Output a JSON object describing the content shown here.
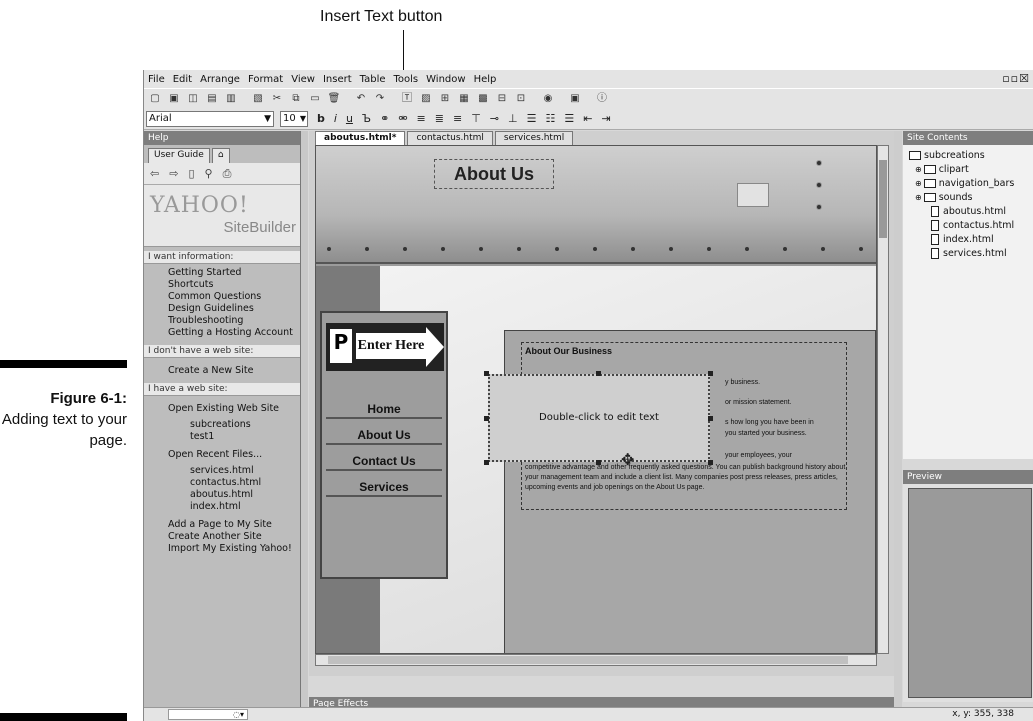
{
  "callout": "Insert Text button",
  "caption": {
    "label": "Figure 6-1:",
    "text": "Adding text to your page."
  },
  "menubar": {
    "items": [
      "File",
      "Edit",
      "Arrange",
      "Format",
      "View",
      "Insert",
      "Table",
      "Tools",
      "Window",
      "Help"
    ]
  },
  "format": {
    "font": "Arial",
    "size": "10"
  },
  "help_panel": {
    "title": "Help",
    "tab_guide": "User Guide",
    "yahoo": "YAHOO!",
    "sitebuilder": "SiteBuilder",
    "want_info": "I want information:",
    "info_links": [
      "Getting Started",
      "Shortcuts",
      "Common Questions",
      "Design Guidelines",
      "Troubleshooting",
      "Getting a Hosting Account"
    ],
    "no_site": "I don't have a web site:",
    "create_new": "Create a New Site",
    "have_site": "I have a web site:",
    "open_existing": "Open Existing Web Site",
    "sites": [
      "subcreations",
      "test1"
    ],
    "open_recent": "Open Recent Files...",
    "recent": [
      "services.html",
      "contactus.html",
      "aboutus.html",
      "index.html"
    ],
    "more": [
      "Add a Page to My Site",
      "Create Another Site",
      "Import My Existing Yahoo!"
    ]
  },
  "doc_tabs": [
    "aboutus.html*",
    "contactus.html",
    "services.html"
  ],
  "page": {
    "title": "About Us",
    "enter": "Enter Here",
    "nav": [
      "Home",
      "About Us",
      "Contact Us",
      "Services"
    ],
    "biz_heading": "About Our Business",
    "frag1": "y business.",
    "frag2": "or mission statement.",
    "frag3": "s how long you have been in",
    "frag4": "you started your business.",
    "frag5": "your employees, your",
    "biz_para": "competitive advantage and other frequently asked questions. You can publish background history about your management team and include a client list. Many companies post press releases, press articles, upcoming events and job openings on the About Us page.",
    "new_text": "Double-click to edit text"
  },
  "effects_title": "Page Effects",
  "site_contents": {
    "title": "Site Contents",
    "root": "subcreations",
    "folders": [
      "clipart",
      "navigation_bars",
      "sounds"
    ],
    "files": [
      "aboutus.html",
      "contactus.html",
      "index.html",
      "services.html"
    ]
  },
  "preview_title": "Preview",
  "status": {
    "coords": "x, y: 355, 338"
  }
}
